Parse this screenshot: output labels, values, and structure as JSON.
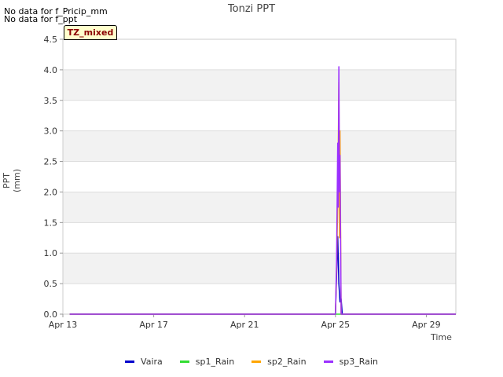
{
  "no_data_messages": [
    "No data for f_Pricip_mm",
    "No data for f_ppt"
  ],
  "badge": "TZ_mixed",
  "chart_data": {
    "type": "line",
    "title": "Tonzi PPT",
    "xlabel": "Time",
    "ylabel": "PPT (mm)",
    "ylim": [
      0,
      4.5
    ],
    "xlim": [
      "Apr 13",
      "Apr 30.3"
    ],
    "yticks": [
      "0.0",
      "0.5",
      "1.0",
      "1.5",
      "2.0",
      "2.5",
      "3.0",
      "3.5",
      "4.0",
      "4.5"
    ],
    "xticks": [
      "Apr 13",
      "Apr 17",
      "Apr 21",
      "Apr 25",
      "Apr 29"
    ],
    "grid": true,
    "legend_position": "bottom",
    "series": [
      {
        "name": "Vaira",
        "color": "#0000cc",
        "points": [
          [
            "Apr 13.3",
            0
          ],
          [
            "Apr 25.0",
            0
          ],
          [
            "Apr 25.1",
            1.27
          ],
          [
            "Apr 25.15",
            0.5
          ],
          [
            "Apr 25.2",
            0.2
          ],
          [
            "Apr 25.25",
            0.25
          ],
          [
            "Apr 25.3",
            0
          ],
          [
            "Apr 30.3",
            0
          ]
        ]
      },
      {
        "name": "sp1_Rain",
        "color": "#33dd33",
        "points": [
          [
            "Apr 13.3",
            0
          ],
          [
            "Apr 30.3",
            0
          ]
        ]
      },
      {
        "name": "sp2_Rain",
        "color": "#ffa500",
        "points": [
          [
            "Apr 13.3",
            0
          ],
          [
            "Apr 25.0",
            0
          ],
          [
            "Apr 25.05",
            0.8
          ],
          [
            "Apr 25.1",
            1.8
          ],
          [
            "Apr 25.15",
            3.8
          ],
          [
            "Apr 25.18",
            1.25
          ],
          [
            "Apr 25.2",
            3.0
          ],
          [
            "Apr 25.25",
            0
          ],
          [
            "Apr 30.3",
            0
          ]
        ]
      },
      {
        "name": "sp3_Rain",
        "color": "#9b30ff",
        "points": [
          [
            "Apr 13.3",
            0
          ],
          [
            "Apr 25.0",
            0
          ],
          [
            "Apr 25.05",
            0.9
          ],
          [
            "Apr 25.1",
            2.8
          ],
          [
            "Apr 25.12",
            1.75
          ],
          [
            "Apr 25.15",
            4.05
          ],
          [
            "Apr 25.18",
            2.0
          ],
          [
            "Apr 25.2",
            2.6
          ],
          [
            "Apr 25.25",
            0
          ],
          [
            "Apr 30.3",
            0
          ]
        ]
      }
    ]
  }
}
